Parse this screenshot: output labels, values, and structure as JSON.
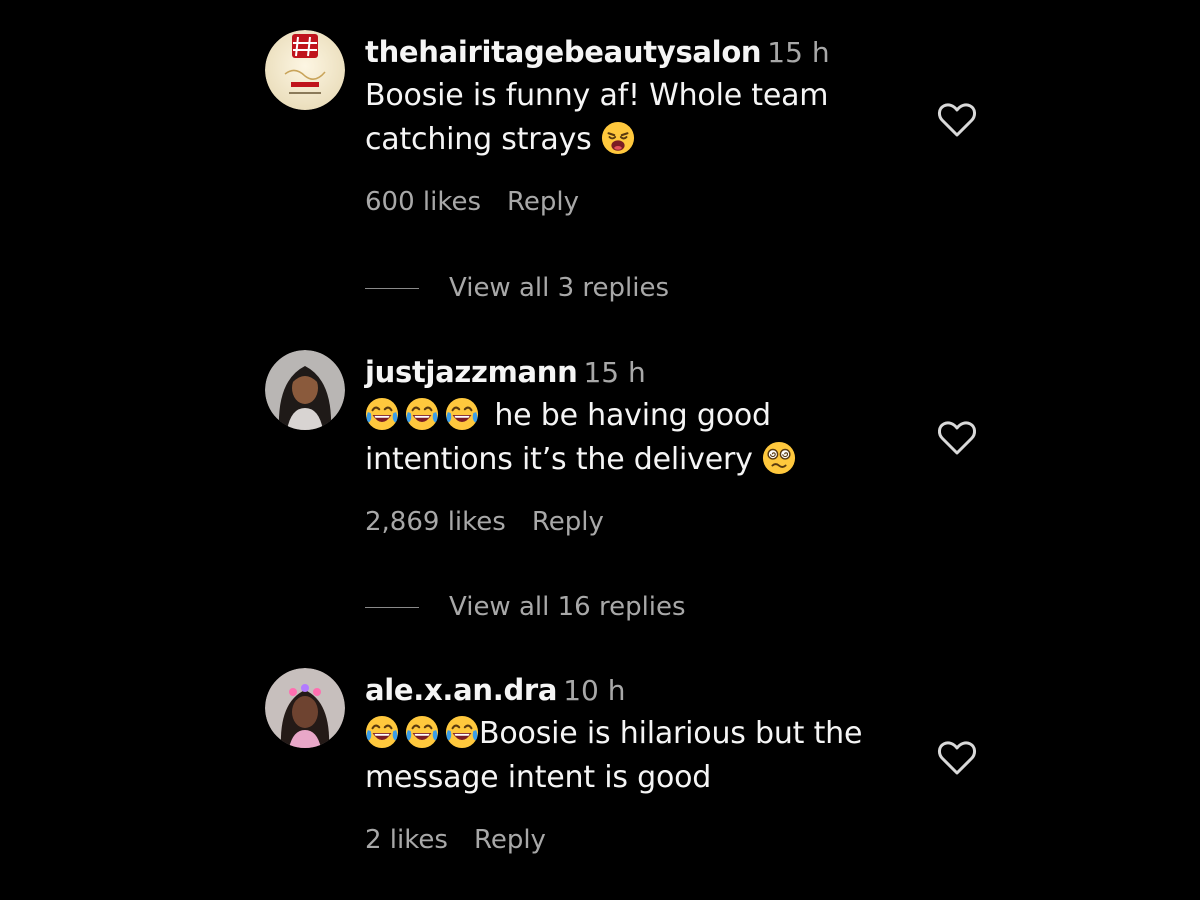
{
  "comments": [
    {
      "username": "thehairitagebeautysalon",
      "time": "15 h",
      "line1": "Boosie is funny af! Whole team",
      "line2": "catching strays",
      "likes": "600 likes",
      "reply": "Reply",
      "avatar_icon": "salon-logo-avatar",
      "emojis": [
        "weary-face-emoji"
      ]
    },
    {
      "username": "justjazzmann",
      "time": "15 h",
      "line1": "he be having good",
      "line2": "intentions it’s the delivery",
      "likes": "2,869 likes",
      "reply": "Reply",
      "avatar_icon": "profile-photo-avatar",
      "emojis": [
        "tears-of-joy-emoji",
        "tears-of-joy-emoji",
        "tears-of-joy-emoji",
        "dizzy-face-emoji"
      ]
    },
    {
      "username": "ale.x.an.dra",
      "time": "10 h",
      "line1": "Boosie is hilarious but the",
      "line2": "message intent is good",
      "likes": "2 likes",
      "reply": "Reply",
      "avatar_icon": "profile-photo-avatar",
      "emojis": [
        "tears-of-joy-emoji",
        "tears-of-joy-emoji",
        "tears-of-joy-emoji"
      ]
    }
  ],
  "view_replies": [
    "View all 3 replies",
    "View all 16 replies"
  ],
  "colors": {
    "background": "#000000",
    "primary_text": "#f5f5f5",
    "secondary_text": "#a8a8a8",
    "emoji_yellow": "#ffc83d"
  }
}
